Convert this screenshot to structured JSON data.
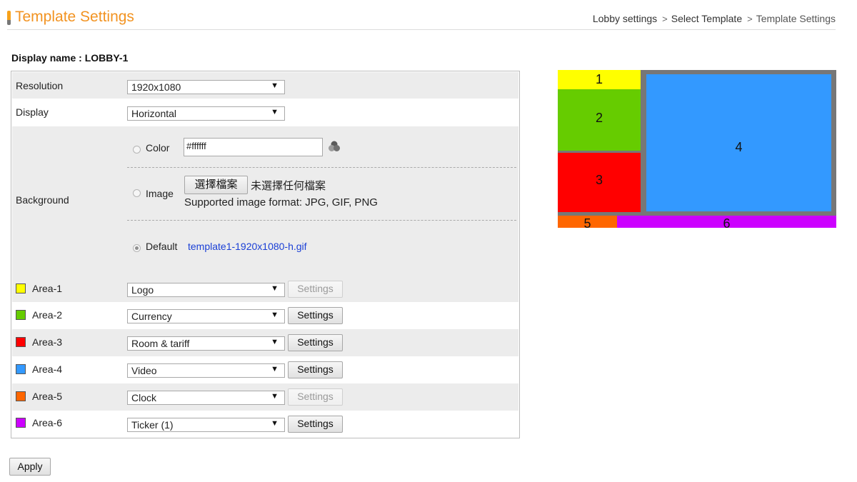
{
  "header": {
    "title": "Template Settings",
    "breadcrumb": {
      "item1": "Lobby settings",
      "sep1": ">",
      "item2": "Select Template",
      "sep2": ">",
      "current": "Template Settings"
    }
  },
  "display_name": "Display name :  LOBBY-1",
  "form": {
    "resolution": {
      "label": "Resolution",
      "value": "1920x1080"
    },
    "display": {
      "label": "Display",
      "value": "Horizontal"
    },
    "background": {
      "label": "Background",
      "color_label": "Color",
      "color_value": "#ffffff",
      "image_label": "Image",
      "choose_file_button": "選擇檔案",
      "no_file_text": "未選擇任何檔案",
      "supported_formats": "Supported image format: JPG, GIF, PNG",
      "default_label": "Default",
      "default_file": "template1-1920x1080-h.gif",
      "selected_option": "Default"
    },
    "areas": [
      {
        "label": "Area-1",
        "value": "Logo",
        "settings_label": "Settings",
        "settings_enabled": false,
        "color": "#ffff00"
      },
      {
        "label": "Area-2",
        "value": "Currency",
        "settings_label": "Settings",
        "settings_enabled": true,
        "color": "#66cc00"
      },
      {
        "label": "Area-3",
        "value": "Room & tariff",
        "settings_label": "Settings",
        "settings_enabled": true,
        "color": "#ff0000"
      },
      {
        "label": "Area-4",
        "value": "Video",
        "settings_label": "Settings",
        "settings_enabled": true,
        "color": "#3399ff"
      },
      {
        "label": "Area-5",
        "value": "Clock",
        "settings_label": "Settings",
        "settings_enabled": false,
        "color": "#ff6600"
      },
      {
        "label": "Area-6",
        "value": "Ticker (1)",
        "settings_label": "Settings",
        "settings_enabled": true,
        "color": "#cc00ff"
      }
    ],
    "apply_button": "Apply"
  },
  "preview": {
    "zones": [
      {
        "number": "1",
        "color": "#ffff00"
      },
      {
        "number": "2",
        "color": "#66cc00"
      },
      {
        "number": "3",
        "color": "#ff0000"
      },
      {
        "number": "4",
        "color": "#3399ff"
      },
      {
        "number": "5",
        "color": "#ff6600"
      },
      {
        "number": "6",
        "color": "#cc00ff"
      }
    ],
    "frame_color": "#777777"
  },
  "colors": {
    "accent": "#f29321",
    "link": "#1a3fd6",
    "row_gray": "#ececec"
  },
  "icons": {
    "color_picker": "color-picker-icon"
  }
}
